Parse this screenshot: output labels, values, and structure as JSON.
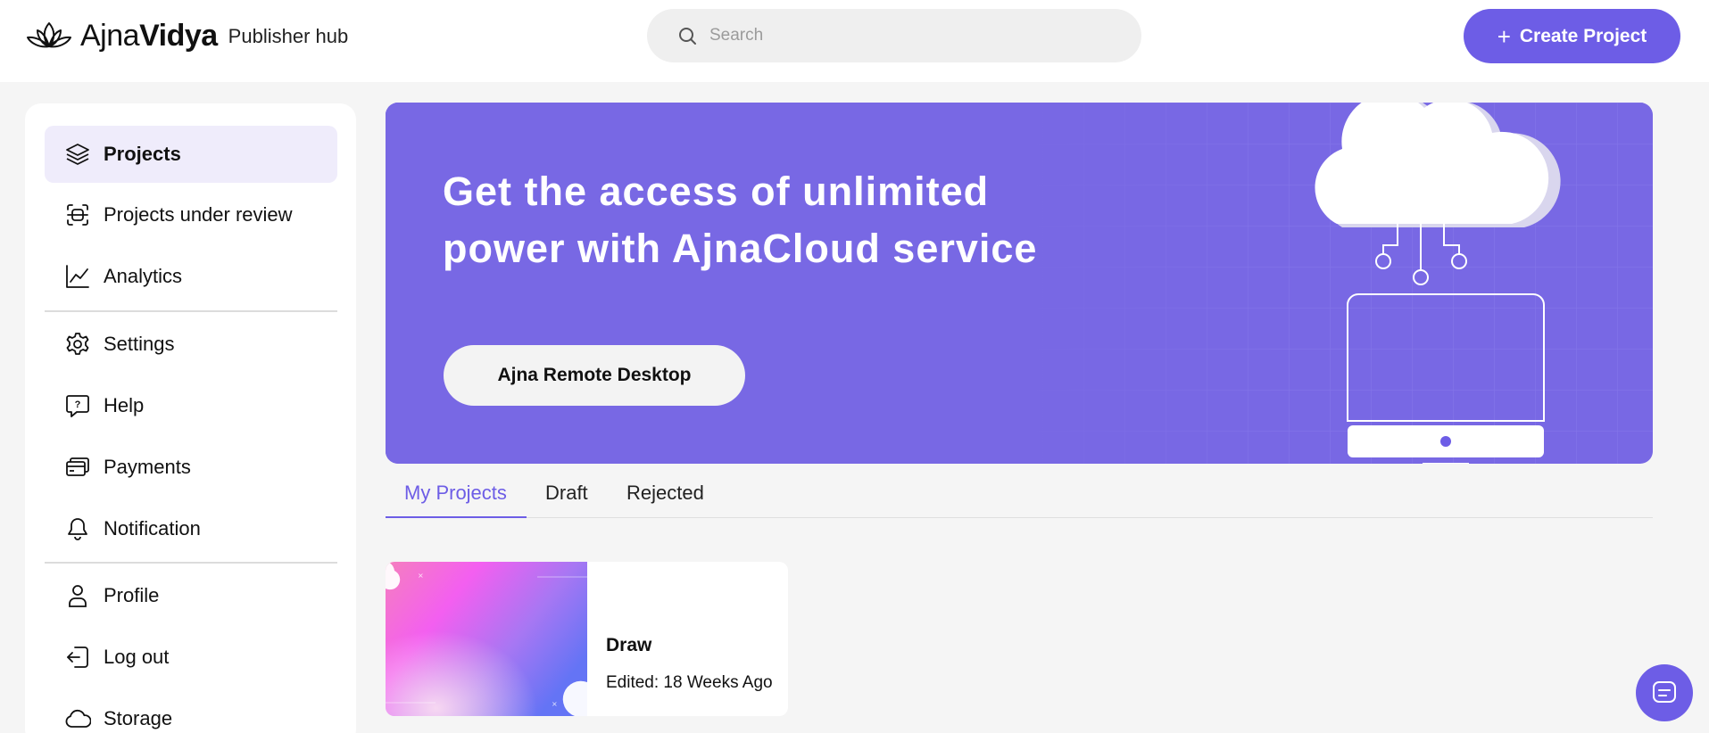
{
  "app": {
    "brand_prefix": "Ajna",
    "brand_bold": "Vidya",
    "brand_sub": "Publisher hub",
    "logo_icon": "lotus-icon"
  },
  "header": {
    "search_placeholder": "Search",
    "search_value": "",
    "create_label": "Create Project"
  },
  "sidebar": {
    "items": [
      {
        "label": "Projects",
        "icon": "layers-icon",
        "active": true
      },
      {
        "label": "Projects under review",
        "icon": "review-icon"
      },
      {
        "label": "Analytics",
        "icon": "chart-line-icon"
      },
      {
        "label": "Settings",
        "icon": "gear-icon"
      },
      {
        "label": "Help",
        "icon": "help-icon"
      },
      {
        "label": "Payments",
        "icon": "card-icon"
      },
      {
        "label": "Notification",
        "icon": "bell-icon"
      },
      {
        "label": "Profile",
        "icon": "user-icon"
      },
      {
        "label": "Log out",
        "icon": "logout-icon"
      },
      {
        "label": "Storage",
        "icon": "cloud-icon"
      }
    ]
  },
  "banner": {
    "title": "Get the access of unlimited power with AjnaCloud service",
    "button_label": "Ajna Remote Desktop"
  },
  "tabs": [
    {
      "label": "My Projects",
      "active": true
    },
    {
      "label": "Draft"
    },
    {
      "label": "Rejected"
    }
  ],
  "projects": [
    {
      "title": "Draw",
      "edited": "Edited: 18 Weeks Ago"
    }
  ],
  "colors": {
    "accent": "#6d5de6",
    "banner": "#7868e4",
    "active_nav_bg": "#efecfb",
    "page_bg": "#f5f5f5"
  }
}
